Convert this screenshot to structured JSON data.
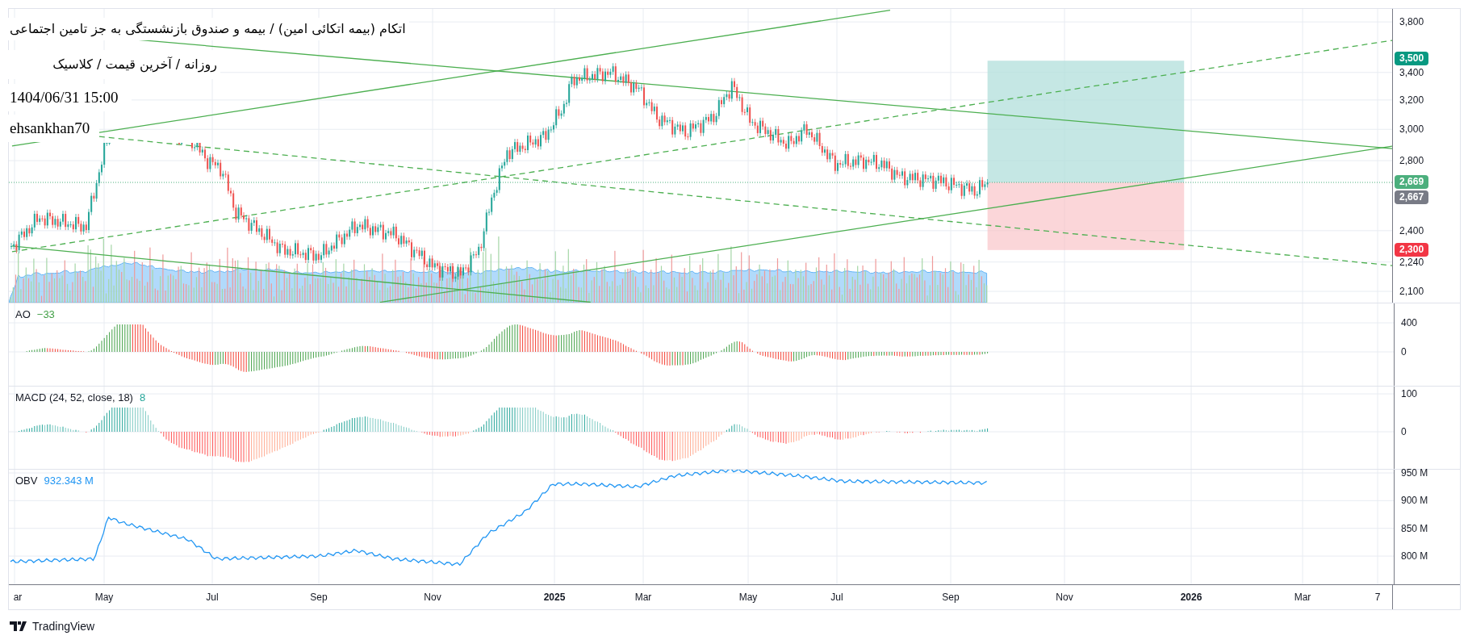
{
  "overlay": {
    "title": "اتکام (بیمه اتکائی امین) / بیمه و صندوق بازنشستگی به جز تامین اجتماعی",
    "subtitle": "روزانه / آخرین قیمت / کلاسیک",
    "timestamp": "1404/06/31 15:00",
    "author": "ehsankhan70"
  },
  "price_pane": {
    "axis_ticks": [
      "3,800",
      "3,400",
      "3,200",
      "3,000",
      "2,800",
      "2,400",
      "2,240",
      "2,100"
    ],
    "price_labels": [
      {
        "text": "3,500",
        "color": "#089981"
      },
      {
        "text": "2,669",
        "color": "#4caf7d"
      },
      {
        "text": "2,667",
        "color": "#787b86"
      },
      {
        "text": "2,300",
        "color": "#f23645"
      }
    ]
  },
  "ao_pane": {
    "name": "AO",
    "value": "−33",
    "axis_ticks": [
      "400",
      "0"
    ]
  },
  "macd_pane": {
    "name": "MACD (24, 52, close, 18)",
    "value": "8",
    "axis_ticks": [
      "100",
      "0"
    ]
  },
  "obv_pane": {
    "name": "OBV",
    "value": "932.343 M",
    "axis_ticks": [
      "950 M",
      "900 M",
      "850 M",
      "800 M"
    ]
  },
  "time_axis": [
    {
      "label": "ar",
      "bold": false
    },
    {
      "label": "May",
      "bold": false
    },
    {
      "label": "Jul",
      "bold": false
    },
    {
      "label": "Sep",
      "bold": false
    },
    {
      "label": "Nov",
      "bold": false
    },
    {
      "label": "2025",
      "bold": true
    },
    {
      "label": "Mar",
      "bold": false
    },
    {
      "label": "May",
      "bold": false
    },
    {
      "label": "Jul",
      "bold": false
    },
    {
      "label": "Sep",
      "bold": false
    },
    {
      "label": "Nov",
      "bold": false
    },
    {
      "label": "2026",
      "bold": true
    },
    {
      "label": "Mar",
      "bold": false
    },
    {
      "label": "7",
      "bold": false
    }
  ],
  "footer": {
    "brand": "TradingView"
  }
}
